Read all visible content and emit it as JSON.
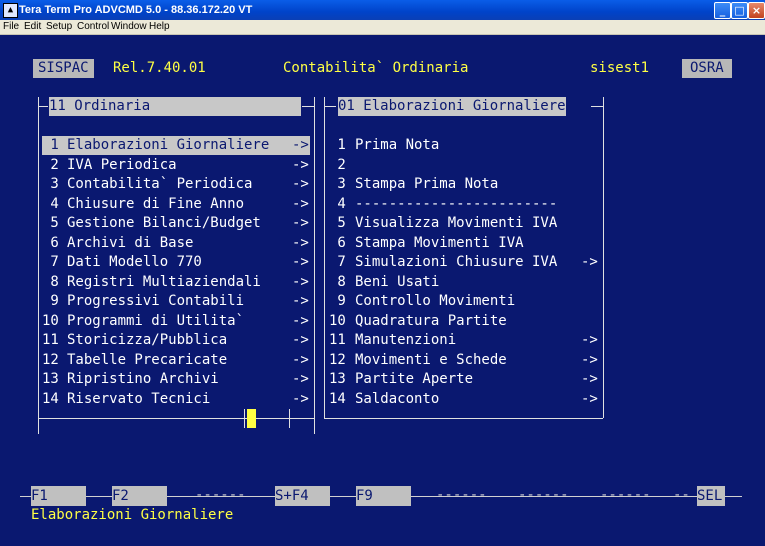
{
  "window": {
    "title": "Tera Term Pro ADVCMD 5.0 - 88.36.172.20 VT",
    "icon_glyph": "▲",
    "controls": {
      "minimize": "_",
      "maximize": "□",
      "close": "×"
    }
  },
  "menubar": [
    "File",
    "Edit",
    "Setup",
    "Control",
    "Window",
    "Help"
  ],
  "header": {
    "system": "SISPAC",
    "release": "Rel.7.40.01",
    "module": "Contabilita` Ordinaria",
    "user": "sisest1",
    "company": "OSRA"
  },
  "left_panel": {
    "title": "11 Ordinaria",
    "items": [
      {
        "num": " 1",
        "label": "Elaborazioni Giornaliere",
        "arrow": "->"
      },
      {
        "num": " 2",
        "label": "IVA Periodica",
        "arrow": "->"
      },
      {
        "num": " 3",
        "label": "Contabilita` Periodica",
        "arrow": "->"
      },
      {
        "num": " 4",
        "label": "Chiusure di Fine Anno",
        "arrow": "->"
      },
      {
        "num": " 5",
        "label": "Gestione Bilanci/Budget",
        "arrow": "->"
      },
      {
        "num": " 6",
        "label": "Archivi di Base",
        "arrow": "->"
      },
      {
        "num": " 7",
        "label": "Dati Modello 770",
        "arrow": "->"
      },
      {
        "num": " 8",
        "label": "Registri Multiaziendali",
        "arrow": "->"
      },
      {
        "num": " 9",
        "label": "Progressivi Contabili",
        "arrow": "->"
      },
      {
        "num": "10",
        "label": "Programmi di Utilita`",
        "arrow": "->"
      },
      {
        "num": "11",
        "label": "Storicizza/Pubblica",
        "arrow": "->"
      },
      {
        "num": "12",
        "label": "Tabelle Precaricate",
        "arrow": "->"
      },
      {
        "num": "13",
        "label": "Ripristino Archivi",
        "arrow": "->"
      },
      {
        "num": "14",
        "label": "Riservato Tecnici",
        "arrow": "->"
      }
    ]
  },
  "right_panel": {
    "title": "01 Elaborazioni Giornaliere",
    "items": [
      {
        "num": " 1",
        "label": "Prima Nota",
        "arrow": ""
      },
      {
        "num": " 2",
        "label": "",
        "arrow": ""
      },
      {
        "num": " 3",
        "label": "Stampa Prima Nota",
        "arrow": ""
      },
      {
        "num": " 4",
        "label": "------------------------",
        "arrow": ""
      },
      {
        "num": " 5",
        "label": "Visualizza Movimenti IVA",
        "arrow": ""
      },
      {
        "num": " 6",
        "label": "Stampa Movimenti IVA",
        "arrow": ""
      },
      {
        "num": " 7",
        "label": "Simulazioni Chiusure IVA",
        "arrow": "->"
      },
      {
        "num": " 8",
        "label": "Beni Usati",
        "arrow": ""
      },
      {
        "num": " 9",
        "label": "Controllo Movimenti",
        "arrow": ""
      },
      {
        "num": "10",
        "label": "Quadratura Partite",
        "arrow": ""
      },
      {
        "num": "11",
        "label": "Manutenzioni",
        "arrow": "->"
      },
      {
        "num": "12",
        "label": "Movimenti e Schede",
        "arrow": "->"
      },
      {
        "num": "13",
        "label": "Partite Aperte",
        "arrow": "->"
      },
      {
        "num": "14",
        "label": "Saldaconto",
        "arrow": "->"
      }
    ]
  },
  "function_keys": [
    "F1",
    "F2",
    "S+F4",
    "F9",
    "SEL"
  ],
  "status_line": "Elaborazioni Giornaliere",
  "colors": {
    "background": "#0a1870",
    "highlight": "#ffff44",
    "text": "#ffffff"
  }
}
